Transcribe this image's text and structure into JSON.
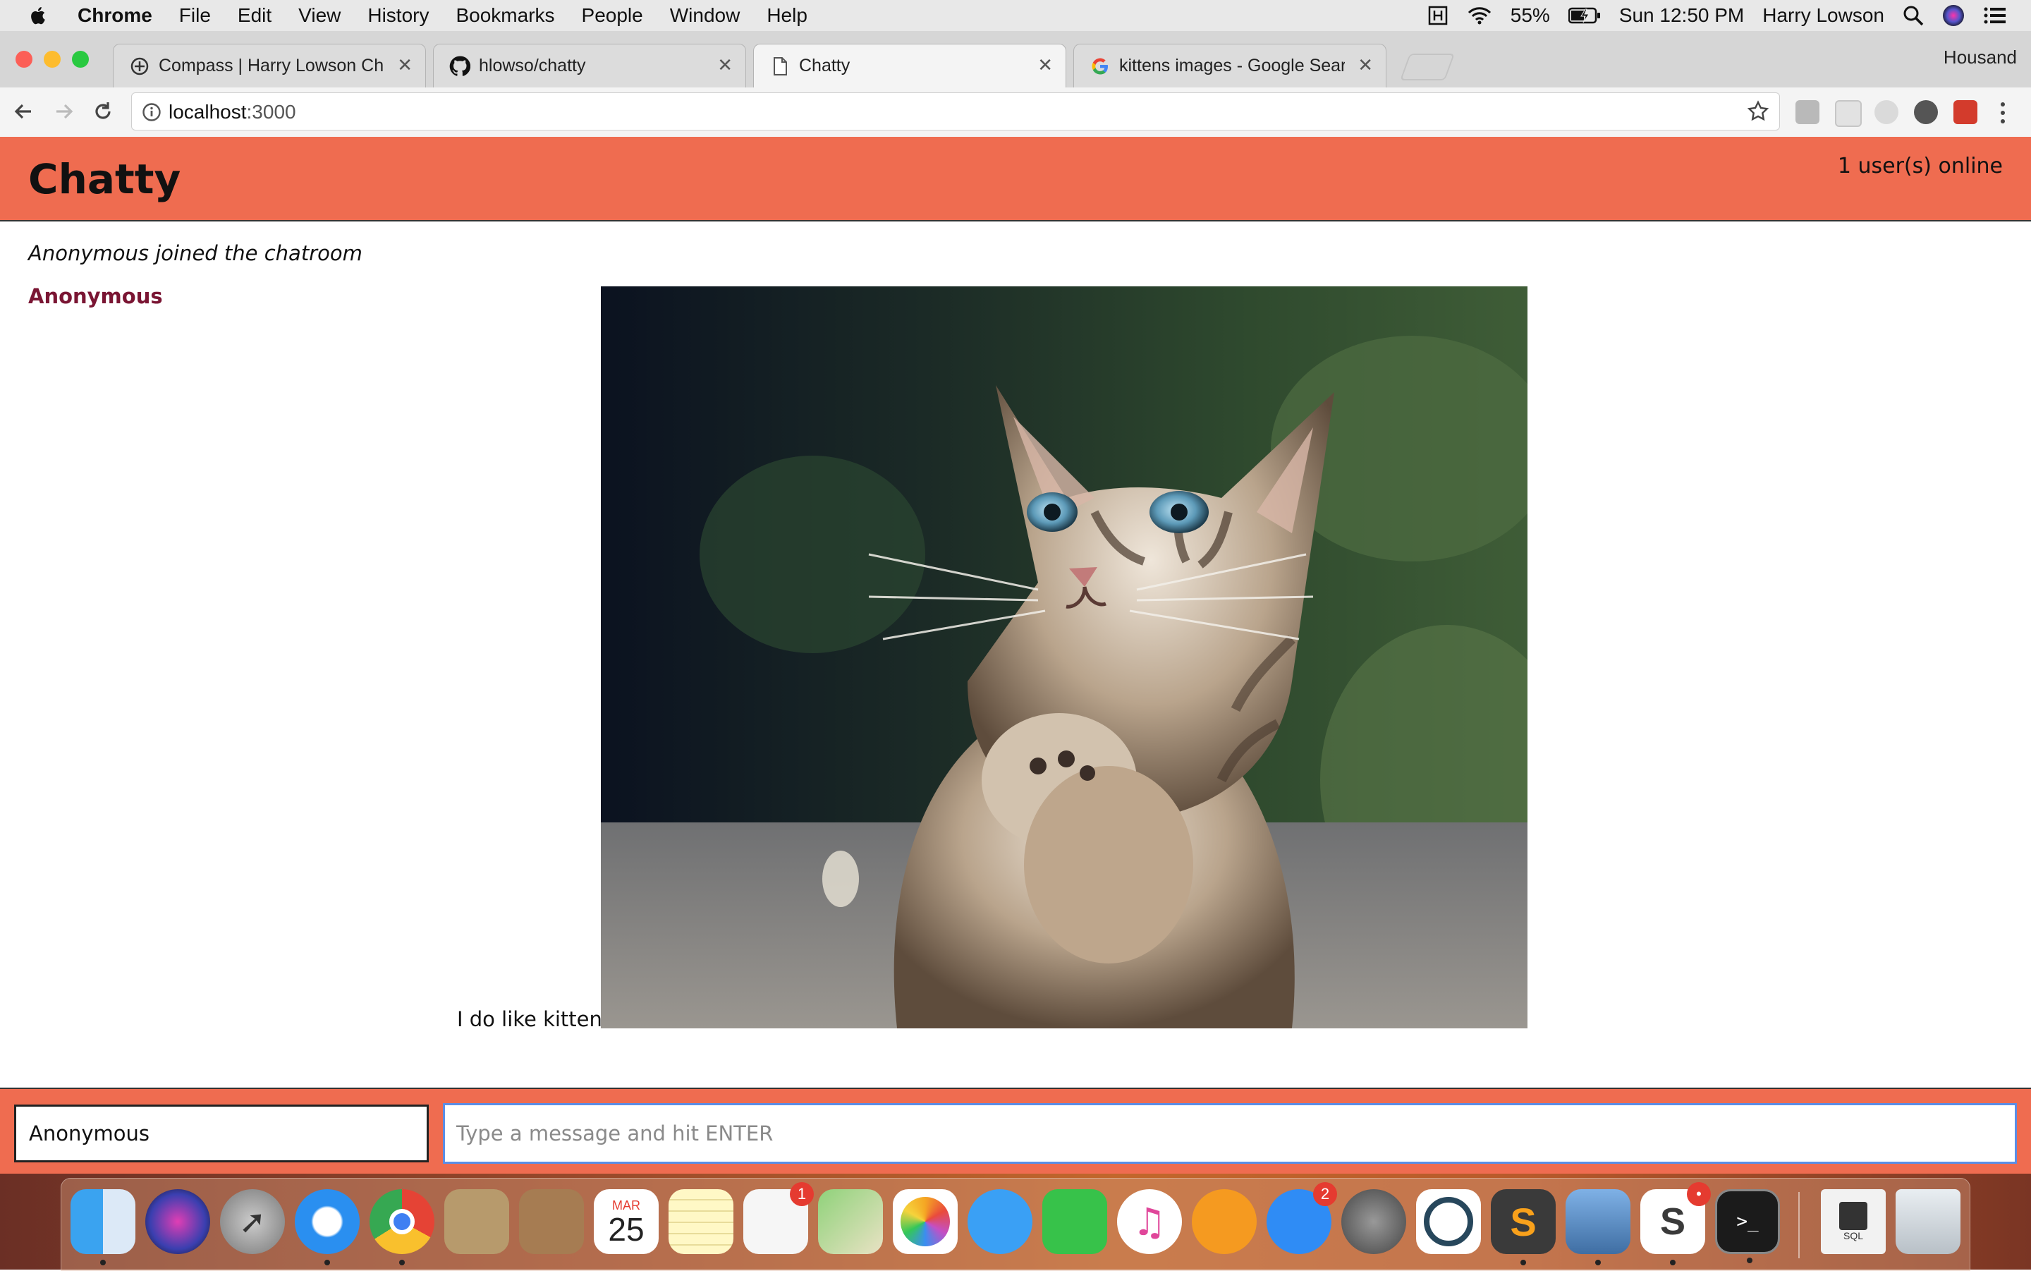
{
  "menubar": {
    "app_name": "Chrome",
    "menus": [
      "File",
      "Edit",
      "View",
      "History",
      "Bookmarks",
      "People",
      "Window",
      "Help"
    ],
    "battery": "55%",
    "clock": "Sun 12:50 PM",
    "user": "Harry Lowson"
  },
  "browser": {
    "tabs": [
      {
        "title": "Compass | Harry Lowson Chat",
        "icon": "compass-icon"
      },
      {
        "title": "hlowso/chatty",
        "icon": "github-icon"
      },
      {
        "title": "Chatty",
        "icon": "page-icon"
      },
      {
        "title": "kittens images - Google Search",
        "icon": "google-icon"
      }
    ],
    "active_tab": 2,
    "profile_name": "Housand",
    "url_host": "localhost",
    "url_port": ":3000"
  },
  "chat": {
    "title": "Chatty",
    "online": "1 user(s) online",
    "notification": "Anonymous joined the chatroom",
    "message": {
      "username": "Anonymous",
      "text": "I do like kittens",
      "image": "kitten-photo"
    }
  },
  "compose": {
    "username_value": "Anonymous",
    "message_placeholder": "Type a message and hit ENTER"
  },
  "colors": {
    "header_bg": "#ef6c50",
    "username_color": "#7a1533",
    "input_focus": "#5b8ee6"
  },
  "dock": {
    "items": [
      {
        "name": "finder-icon"
      },
      {
        "name": "siri-icon"
      },
      {
        "name": "launchpad-icon"
      },
      {
        "name": "safari-icon"
      },
      {
        "name": "chrome-icon"
      },
      {
        "name": "mail-icon"
      },
      {
        "name": "contacts-icon"
      },
      {
        "name": "calendar-icon",
        "month": "MAR",
        "day": "25"
      },
      {
        "name": "notes-icon"
      },
      {
        "name": "reminders-icon",
        "badge": "1"
      },
      {
        "name": "maps-icon"
      },
      {
        "name": "photos-icon"
      },
      {
        "name": "messages-icon"
      },
      {
        "name": "facetime-icon"
      },
      {
        "name": "itunes-icon"
      },
      {
        "name": "ibooks-icon"
      },
      {
        "name": "app-store-icon",
        "badge": "2"
      },
      {
        "name": "system-preferences-icon"
      },
      {
        "name": "compass-icon"
      },
      {
        "name": "sublime-text-icon"
      },
      {
        "name": "preview-icon"
      },
      {
        "name": "slack-icon",
        "badge": "•"
      },
      {
        "name": "terminal-icon"
      },
      {
        "name": "sql-file-icon",
        "label": "SQL"
      },
      {
        "name": "trash-icon"
      }
    ]
  }
}
